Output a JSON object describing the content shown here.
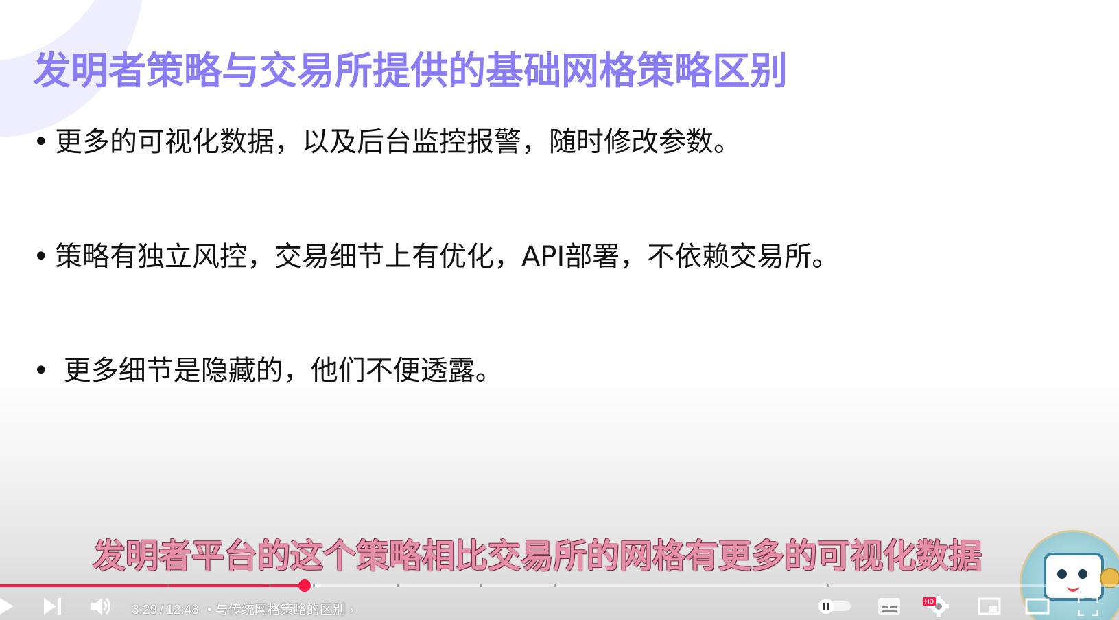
{
  "slide": {
    "title": "发明者策略与交易所提供的基础网格策略区别",
    "bullets": [
      "更多的可视化数据，以及后台监控报警，随时修改参数。",
      "策略有独立风控，交易细节上有优化，API部署，不依赖交易所。",
      " 更多细节是隐藏的，他们不便透露。"
    ],
    "bullet_symbol": "•"
  },
  "caption": {
    "text": "发明者平台的这个策略相比交易所的网格有更多的可视化数据"
  },
  "player": {
    "current_time": "3:29",
    "separator": "/",
    "duration": "12:48",
    "chapter_bullet": "•",
    "chapter_title": "与传统网格策略的区别",
    "chapter_chevron": "›",
    "progress_played_fraction": 0.2724,
    "progress_buffered_fraction": 0.287,
    "hd_badge": "HD",
    "autoplay_enabled": true,
    "colors": {
      "progress": "#ff1744",
      "title": "#8a7cf4",
      "caption": "#e58fa9"
    },
    "icons": [
      "play-icon",
      "next-icon",
      "volume-icon",
      "autoplay-toggle",
      "subtitles-icon",
      "settings-icon",
      "miniplayer-icon",
      "theater-icon",
      "fullscreen-icon"
    ]
  }
}
